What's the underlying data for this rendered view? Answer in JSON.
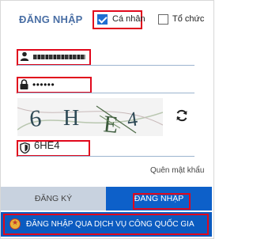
{
  "header": {
    "title": "ĐĂNG NHẬP",
    "account_types": [
      {
        "label": "Cá nhân",
        "checked": true
      },
      {
        "label": "Tổ chức",
        "checked": false
      }
    ]
  },
  "form": {
    "username": {
      "icon": "user-icon",
      "value_masked": true
    },
    "password": {
      "icon": "lock-icon",
      "value": "••••••"
    },
    "captcha": {
      "image_text": "6HE4",
      "refresh_icon": "refresh-icon"
    },
    "captcha_input": {
      "icon": "shield-icon",
      "value": "6HE4"
    },
    "forgot_password": "Quên mật khẩu"
  },
  "actions": {
    "register": "ĐĂNG KÝ",
    "login": "ĐĂNG NHẬP",
    "national_login": "ĐĂNG NHẬP QUA DỊCH VỤ CÔNG QUỐC GIA"
  },
  "colors": {
    "title": "#4a6fa5",
    "primary": "#0d60c9",
    "highlight": "#e1081c"
  }
}
